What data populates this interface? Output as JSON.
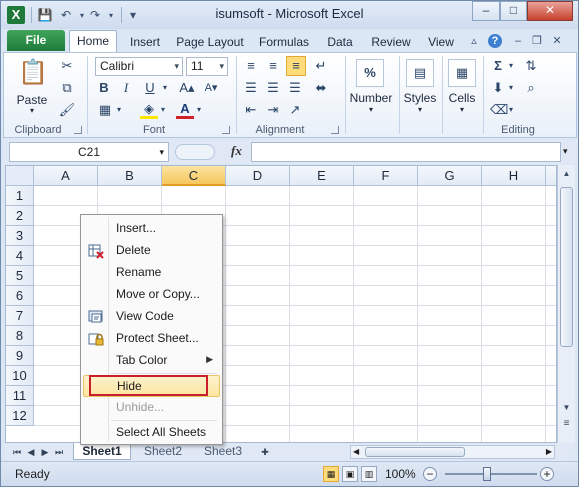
{
  "window": {
    "title": "isumsoft  -  Microsoft Excel",
    "controls": [
      "–",
      "□",
      "✕"
    ]
  },
  "quick_access": {
    "app_icon": "X",
    "save": "💾",
    "undo": "↶",
    "redo": "↷",
    "customize": "▾"
  },
  "ribbon_tabs": [
    "File",
    "Home",
    "Insert",
    "Page Layout",
    "Formulas",
    "Data",
    "Review",
    "View"
  ],
  "ribbon": {
    "clipboard": {
      "paste_label": "Paste",
      "group_label": "Clipboard"
    },
    "font": {
      "name": "Calibri",
      "size": "11",
      "bold": "B",
      "italic": "I",
      "underline": "U",
      "group_label": "Font"
    },
    "alignment": {
      "group_label": "Alignment"
    },
    "number": {
      "icon": "%",
      "label": "Number"
    },
    "styles": {
      "label": "Styles"
    },
    "cells": {
      "label": "Cells"
    },
    "editing": {
      "sum": "Σ",
      "group_label": "Editing"
    }
  },
  "formula_bar": {
    "name_box": "C21",
    "fx_label": "fx",
    "formula": ""
  },
  "grid": {
    "columns": [
      "A",
      "B",
      "C",
      "D",
      "E",
      "F",
      "G",
      "H"
    ],
    "selected_column": "C",
    "rows": [
      "1",
      "2",
      "3",
      "4",
      "5",
      "6",
      "7",
      "8",
      "9",
      "10",
      "11",
      "12"
    ]
  },
  "context_menu": {
    "items": [
      {
        "label": "Insert...",
        "icon": "",
        "state": "normal"
      },
      {
        "label": "Delete",
        "icon": "delete-sheet-icon",
        "state": "normal"
      },
      {
        "label": "Rename",
        "icon": "",
        "state": "normal"
      },
      {
        "label": "Move or Copy...",
        "icon": "",
        "state": "normal"
      },
      {
        "label": "View Code",
        "icon": "view-code-icon",
        "state": "normal"
      },
      {
        "label": "Protect Sheet...",
        "icon": "protect-sheet-icon",
        "state": "normal"
      },
      {
        "label": "Tab Color",
        "icon": "",
        "state": "submenu"
      },
      {
        "label": "Hide",
        "icon": "",
        "state": "highlighted"
      },
      {
        "label": "Unhide...",
        "icon": "",
        "state": "disabled"
      },
      {
        "label": "Select All Sheets",
        "icon": "",
        "state": "normal"
      }
    ]
  },
  "sheet_tabs": [
    "Sheet1",
    "Sheet2",
    "Sheet3"
  ],
  "active_sheet": "Sheet1",
  "status_bar": {
    "ready": "Ready",
    "zoom": "100%",
    "zoom_level": 1.0
  },
  "colors": {
    "accent": "#1f7a3a",
    "highlight": "#fddc79",
    "annotation": "#c8202a"
  }
}
